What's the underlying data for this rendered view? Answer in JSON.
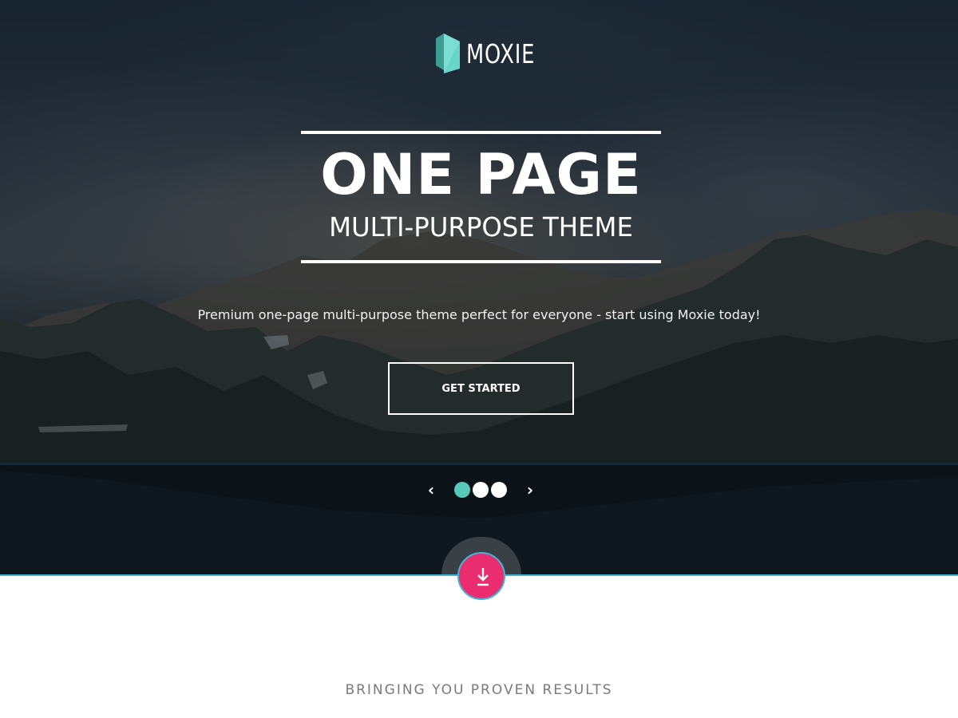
{
  "brand": {
    "name": "MOXIE",
    "logo_icon": "hexagon-prism-logo-icon"
  },
  "hero": {
    "title": "ONE PAGE",
    "subtitle": "MULTI-PURPOSE THEME",
    "tagline": "Premium one-page multi-purpose theme perfect for everyone - start using Moxie today!",
    "cta_label": "GET STARTED",
    "slider": {
      "prev_icon": "chevron-left-icon",
      "prev_glyph": "‹",
      "next_icon": "chevron-right-icon",
      "next_glyph": "›",
      "slide_count": 3,
      "active_slide": 1
    },
    "scroll_icon": "download-arrow-icon"
  },
  "section": {
    "heading": "BRINGING YOU PROVEN RESULTS"
  },
  "colors": {
    "accent_teal": "#58c8bb",
    "accent_blue_line": "#3fb6d3",
    "scroll_button_pink": "#ea2d6f",
    "section_heading_gray": "#7a7a7a"
  }
}
